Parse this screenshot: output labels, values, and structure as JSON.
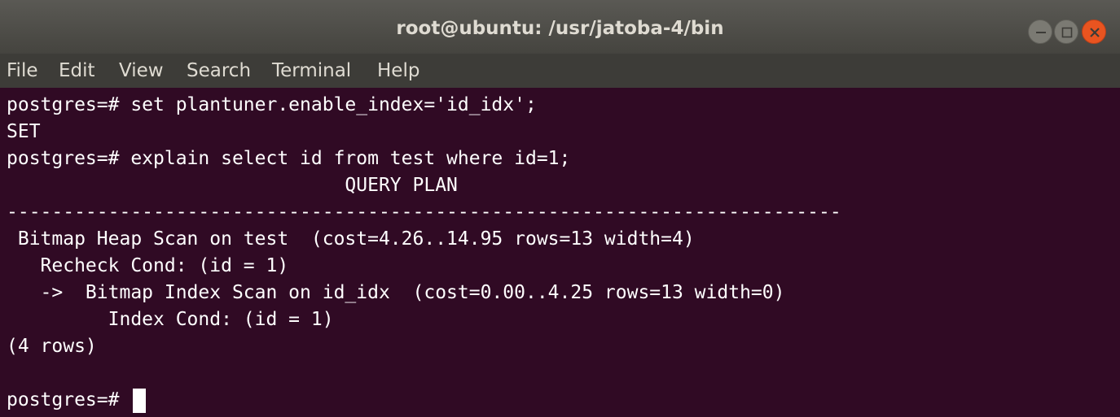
{
  "window": {
    "title": "root@ubuntu: /usr/jatoba-4/bin"
  },
  "menubar": {
    "items": [
      "File",
      "Edit",
      "View",
      "Search",
      "Terminal",
      "Help"
    ]
  },
  "terminal": {
    "lines": [
      "postgres=# set plantuner.enable_index='id_idx';",
      "SET",
      "postgres=# explain select id from test where id=1;",
      "                              QUERY PLAN",
      "--------------------------------------------------------------------------",
      " Bitmap Heap Scan on test  (cost=4.26..14.95 rows=13 width=4)",
      "   Recheck Cond: (id = 1)",
      "   ->  Bitmap Index Scan on id_idx  (cost=0.00..4.25 rows=13 width=0)",
      "         Index Cond: (id = 1)",
      "(4 rows)",
      "",
      "postgres=# "
    ]
  },
  "colors": {
    "terminal_background": "#300a24",
    "terminal_text": "#ffffff",
    "titlebar": "#4f4e4a",
    "close_button": "#e95420"
  }
}
